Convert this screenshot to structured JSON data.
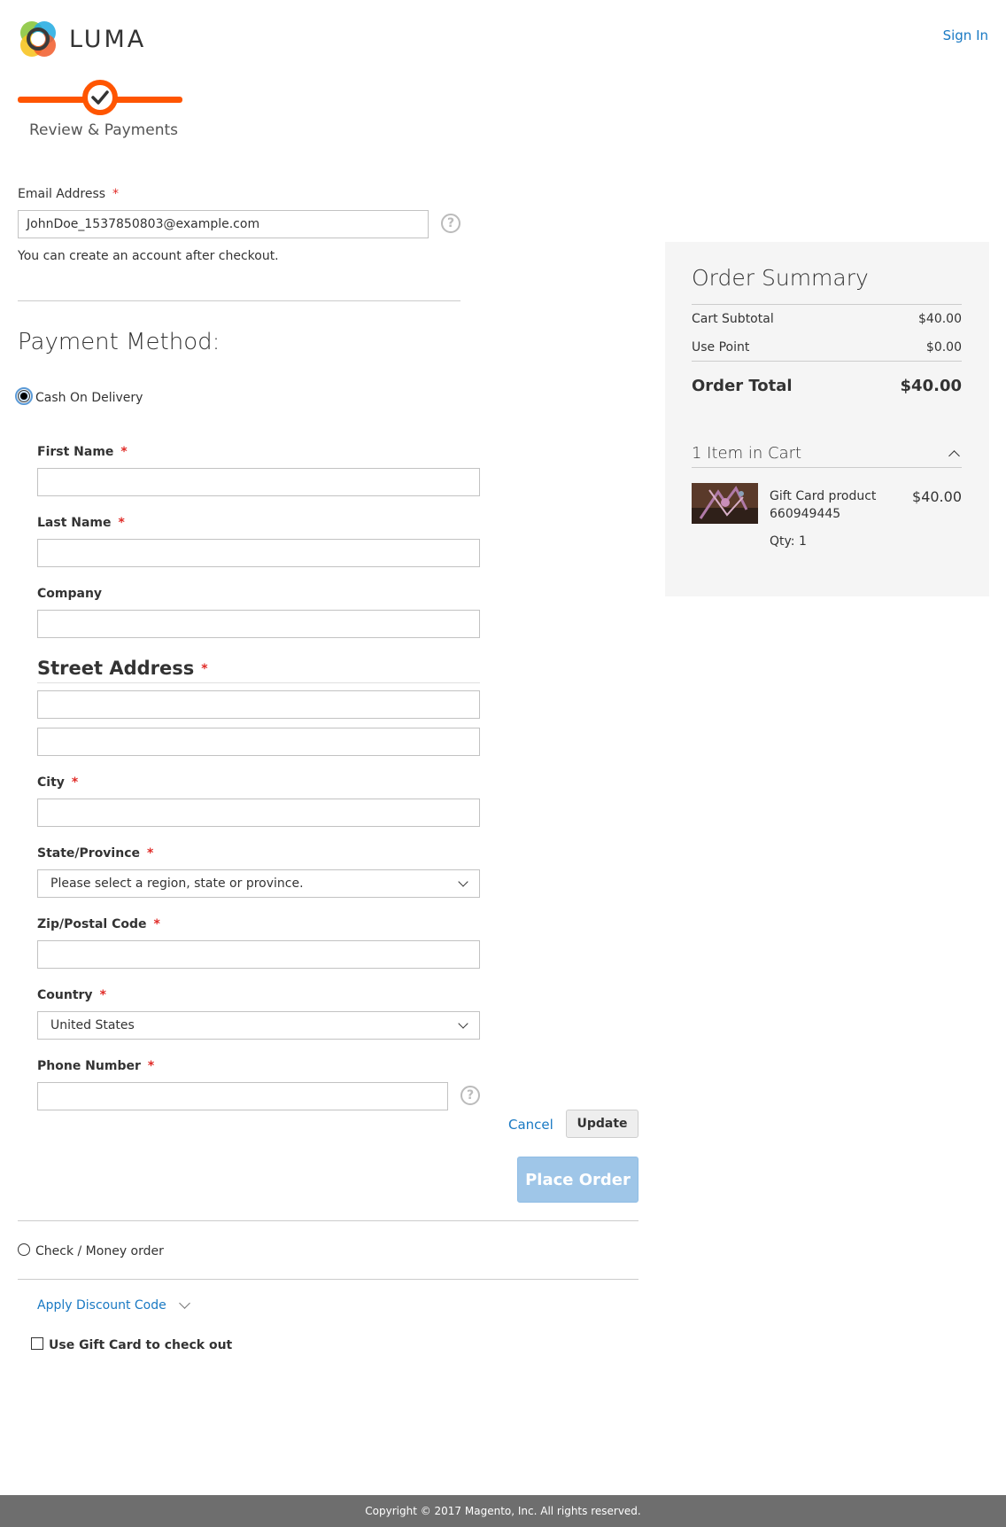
{
  "header": {
    "logo_text": "LUMA",
    "sign_in": "Sign In"
  },
  "progress": {
    "step_label": "Review & Payments"
  },
  "email": {
    "label": "Email Address",
    "required": "*",
    "value": "JohnDoe_1537850803@example.com",
    "note": "You can create an account after checkout.",
    "help_icon": "question-icon"
  },
  "payment": {
    "heading": "Payment Method:",
    "methods": [
      {
        "label": "Cash On Delivery",
        "selected": true
      },
      {
        "label": "Check / Money order",
        "selected": false
      }
    ]
  },
  "address_form": {
    "first_name": "First Name",
    "last_name": "Last Name",
    "company": "Company",
    "street_address": "Street Address",
    "city": "City",
    "state_label": "State/Province",
    "state_value": "Please select a region, state or province.",
    "zip": "Zip/Postal Code",
    "country_label": "Country",
    "country_value": "United States",
    "phone": "Phone Number",
    "required": "*",
    "cancel": "Cancel",
    "update": "Update",
    "place_order": "Place Order"
  },
  "discount": {
    "label": "Apply Discount Code"
  },
  "gift_card": {
    "label": "Use Gift Card to check out",
    "checked": false
  },
  "summary": {
    "title": "Order Summary",
    "rows": [
      {
        "label": "Cart Subtotal",
        "value": "$40.00"
      },
      {
        "label": "Use Point",
        "value": "$0.00"
      }
    ],
    "total_label": "Order Total",
    "total_value": "$40.00",
    "items_label": "1 Item in Cart",
    "item": {
      "name": "Gift Card product",
      "sku": "660949445",
      "qty": "Qty: 1",
      "price": "$40.00"
    }
  },
  "footer": {
    "copyright": "Copyright © 2017 Magento, Inc. All rights reserved."
  },
  "colors": {
    "accent_orange": "#ff5501",
    "link_blue": "#1979c3",
    "required_red": "#e02b27",
    "place_order_bg": "#9fc6e8"
  }
}
